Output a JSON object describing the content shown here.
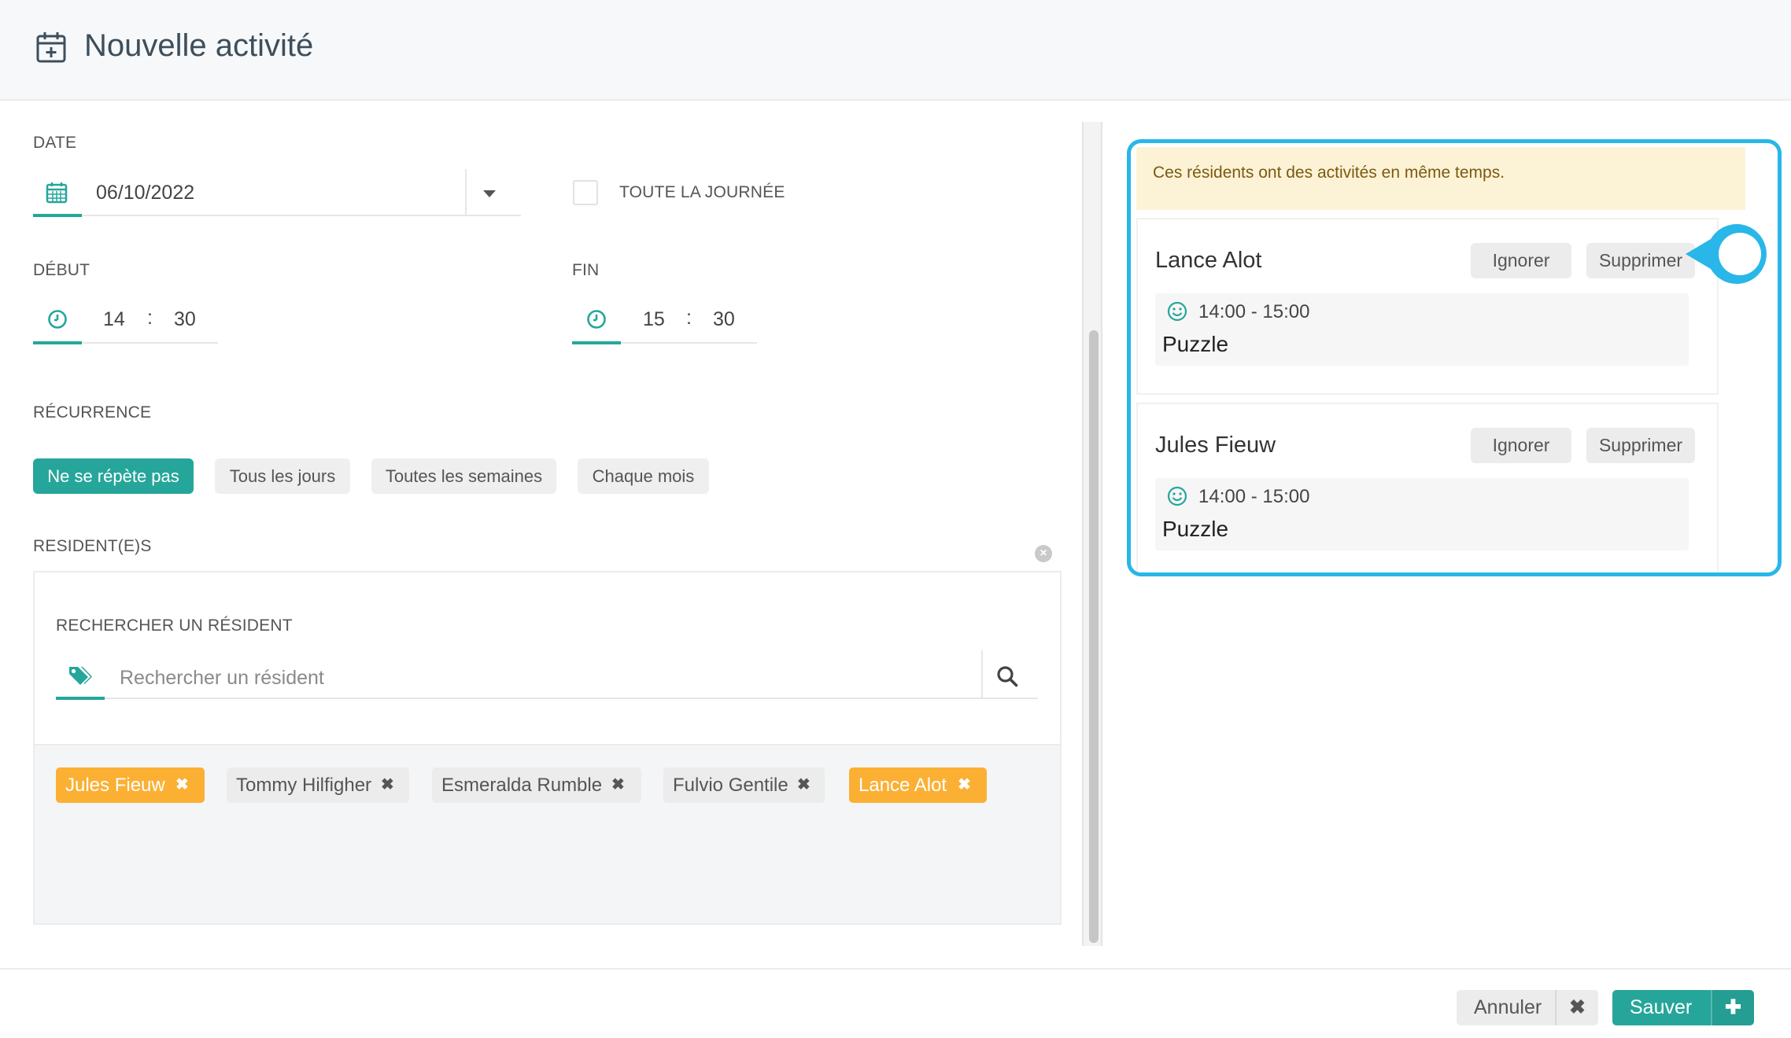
{
  "header": {
    "title": "Nouvelle activité",
    "icon": "calendar-plus-icon"
  },
  "form": {
    "date_label": "DATE",
    "date_value": "06/10/2022",
    "all_day_label": "TOUTE LA JOURNÉE",
    "all_day_checked": false,
    "start_label": "DÉBUT",
    "start_hour": "14",
    "start_minute": "30",
    "end_label": "FIN",
    "end_hour": "15",
    "end_minute": "30",
    "time_separator": ":",
    "recurrence_label": "RÉCURRENCE",
    "recurrence_options": [
      "Ne se répète pas",
      "Tous les jours",
      "Toutes les semaines",
      "Chaque mois"
    ],
    "recurrence_selected": "Ne se répète pas",
    "residents_label": "RESIDENT(E)S",
    "search_label": "RECHERCHER UN RÉSIDENT",
    "search_placeholder": "Rechercher un résident",
    "search_value": "",
    "selected_residents": [
      {
        "name": "Jules Fieuw",
        "status": "conflict",
        "remove": "✖"
      },
      {
        "name": "Tommy Hilfigher",
        "status": "ok",
        "remove": "✖"
      },
      {
        "name": "Esmeralda Rumble",
        "status": "ok",
        "remove": "✖"
      },
      {
        "name": "Fulvio Gentile",
        "status": "ok",
        "remove": "✖"
      },
      {
        "name": "Lance Alot",
        "status": "conflict",
        "remove": "✖"
      }
    ]
  },
  "conflicts": {
    "warning": "Ces résidents ont des activités en même temps.",
    "items": [
      {
        "name": "Lance Alot",
        "ignore_label": "Ignorer",
        "delete_label": "Supprimer",
        "time": "14:00 - 15:00",
        "activity": "Puzzle"
      },
      {
        "name": "Jules Fieuw",
        "ignore_label": "Ignorer",
        "delete_label": "Supprimer",
        "time": "14:00 - 15:00",
        "activity": "Puzzle"
      }
    ]
  },
  "footer": {
    "cancel_label": "Annuler",
    "cancel_icon": "✖",
    "save_label": "Sauver",
    "save_icon": "✚"
  },
  "colors": {
    "accent": "#26a69a",
    "conflict_tag": "#fbb034",
    "highlight": "#29b6e8",
    "warning_bg": "#fcf3d6"
  }
}
